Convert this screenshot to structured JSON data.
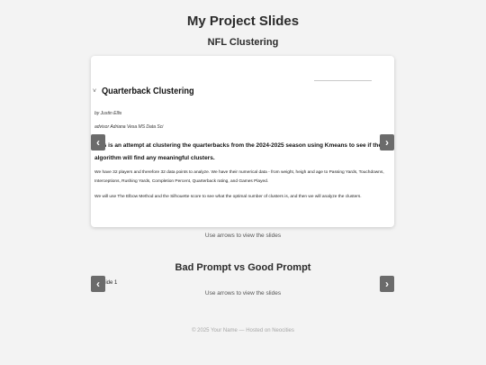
{
  "page": {
    "title": "My Project Slides"
  },
  "section1": {
    "title": "NFL Clustering",
    "slide": {
      "heading": "Quarterback Clustering",
      "author": "by Justin Ellis",
      "advisor": "advisor Adriana Vesa MS Data Sci",
      "intro": "This is an attempt at clustering the quarterbacks from the 2024-2025 season using Kmeans to see if the algorithm will find any meaningful clusters.",
      "para1": "We have 32 players and therefore 32 data points to analyze. We have their numerical data - from weight, heigh and age to Passing Yards, Touchdowns, Interceptions, Rushing Yards, Completion Percent, Quarterback rating, and Games Played.",
      "para2": "We will use The Elbow Method and the Silhouette score to see what the optimal number of clusters is, and then we will analyze the clusters."
    },
    "prev_label": "‹",
    "next_label": "›",
    "hint": "Use arrows to view the slides"
  },
  "section2": {
    "title": "Bad Prompt vs Good Prompt",
    "slide_label": "Slide 1",
    "prev_label": "‹",
    "next_label": "›",
    "hint": "Use arrows to view the slides"
  },
  "footer": {
    "text": "© 2025 Your Name — Hosted on Neocities"
  }
}
